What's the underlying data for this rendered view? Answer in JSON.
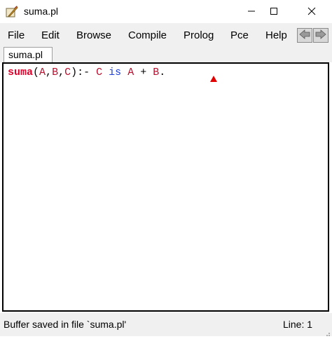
{
  "window": {
    "title": "suma.pl",
    "icons": {
      "app": "feather-quill-icon",
      "minimize": "minimize-icon",
      "maximize": "maximize-icon",
      "close": "close-icon"
    }
  },
  "menu": {
    "items": [
      "File",
      "Edit",
      "Browse",
      "Compile",
      "Prolog",
      "Pce",
      "Help"
    ],
    "nav_icons": [
      "arrow-left-icon",
      "arrow-right-icon"
    ]
  },
  "tabs": [
    {
      "label": "suma.pl",
      "active": true
    }
  ],
  "editor": {
    "tokens": [
      {
        "text": "suma",
        "kind": "pred"
      },
      {
        "text": "(",
        "kind": "punct"
      },
      {
        "text": "A",
        "kind": "var"
      },
      {
        "text": ",",
        "kind": "punct"
      },
      {
        "text": "B",
        "kind": "var"
      },
      {
        "text": ",",
        "kind": "punct"
      },
      {
        "text": "C",
        "kind": "var"
      },
      {
        "text": "):- ",
        "kind": "punct"
      },
      {
        "text": "C",
        "kind": "var"
      },
      {
        "text": " ",
        "kind": "punct"
      },
      {
        "text": "is",
        "kind": "kw"
      },
      {
        "text": " ",
        "kind": "punct"
      },
      {
        "text": "A",
        "kind": "var"
      },
      {
        "text": " + ",
        "kind": "punct"
      },
      {
        "text": "B",
        "kind": "var"
      },
      {
        "text": ".",
        "kind": "punct"
      }
    ],
    "colors": {
      "pred": "#e0002a",
      "var": "#b8102f",
      "kw": "#1f3fd6",
      "marker": "#e00000"
    },
    "marker_icon": "error-marker-icon"
  },
  "status": {
    "message": "Buffer saved in file `suma.pl'",
    "line": "Line: 1"
  }
}
